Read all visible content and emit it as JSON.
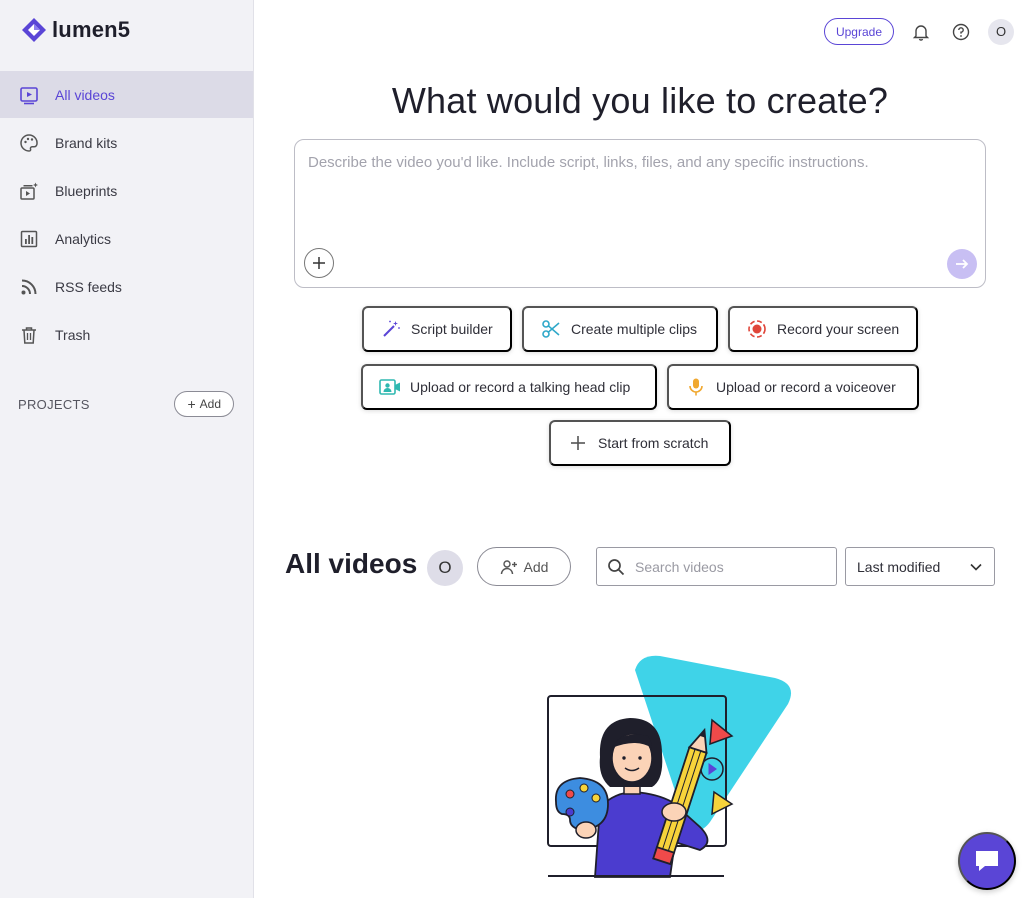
{
  "brand": {
    "name": "lumen5",
    "accent": "#5a45d6"
  },
  "sidebar": {
    "items": [
      {
        "label": "All videos",
        "icon": "video-library-icon",
        "active": true
      },
      {
        "label": "Brand kits",
        "icon": "palette-icon",
        "active": false
      },
      {
        "label": "Blueprints",
        "icon": "blueprint-icon",
        "active": false
      },
      {
        "label": "Analytics",
        "icon": "analytics-icon",
        "active": false
      },
      {
        "label": "RSS feeds",
        "icon": "rss-icon",
        "active": false
      },
      {
        "label": "Trash",
        "icon": "trash-icon",
        "active": false
      }
    ],
    "projects_label": "PROJECTS",
    "add_label": "Add"
  },
  "topbar": {
    "upgrade_label": "Upgrade",
    "avatar_initial": "O"
  },
  "main": {
    "headline": "What would you like to create?",
    "prompt_placeholder": "Describe the video you'd like. Include script, links, files, and any specific instructions.",
    "chips": [
      {
        "label": "Script builder",
        "icon": "magic-wand-icon"
      },
      {
        "label": "Create multiple clips",
        "icon": "scissors-icon"
      },
      {
        "label": "Record your screen",
        "icon": "record-icon"
      },
      {
        "label": "Upload or record a talking head clip",
        "icon": "camera-person-icon"
      },
      {
        "label": "Upload or record a voiceover",
        "icon": "microphone-icon"
      },
      {
        "label": "Start from scratch",
        "icon": "plus-icon"
      }
    ]
  },
  "videos": {
    "title": "All videos",
    "member_initial": "O",
    "add_label": "Add",
    "search_placeholder": "Search videos",
    "sort_value": "Last modified"
  }
}
